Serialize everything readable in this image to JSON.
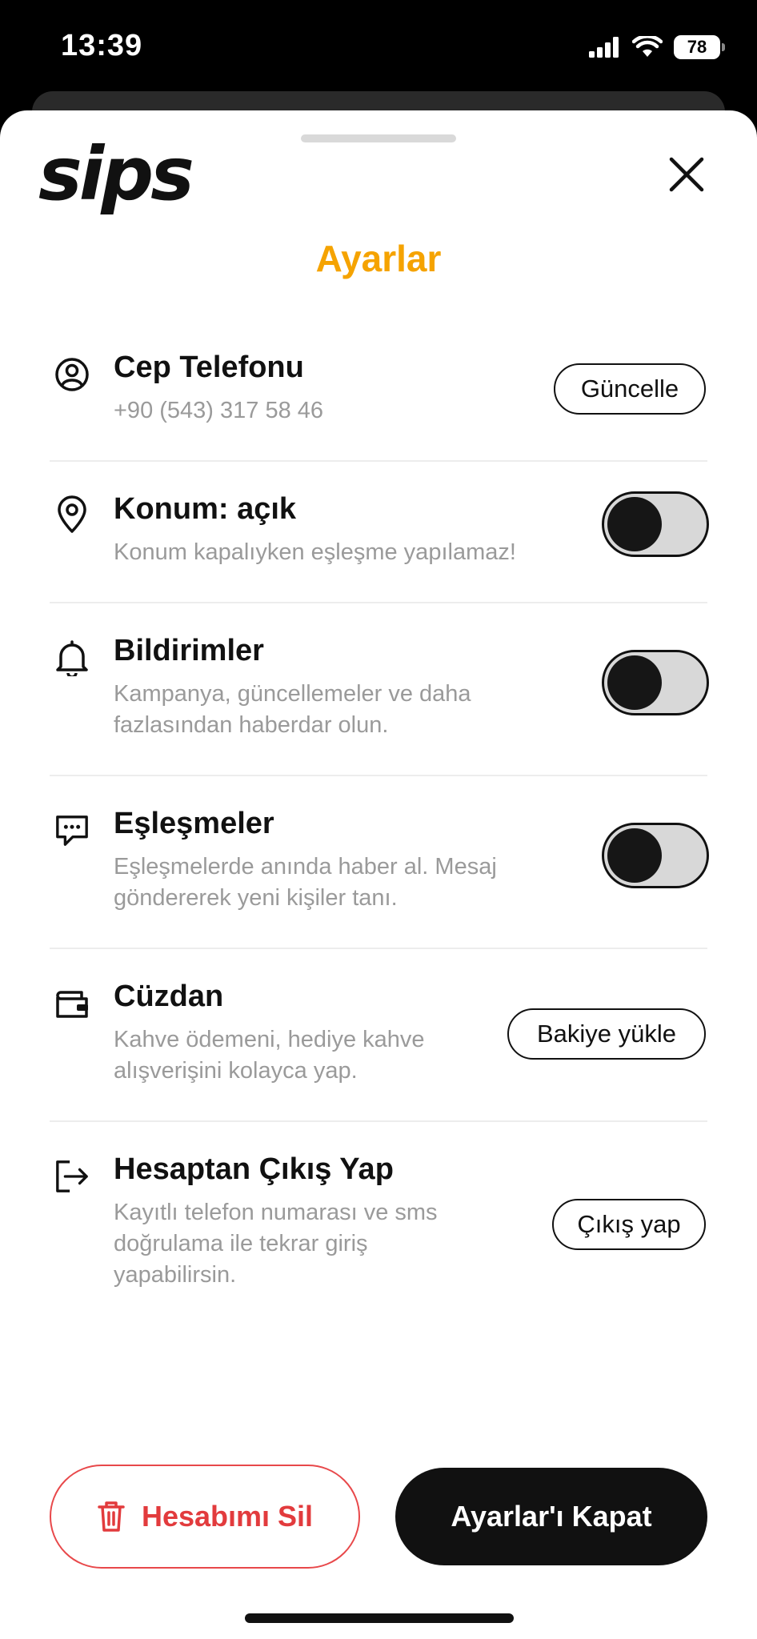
{
  "status_bar": {
    "time": "13:39",
    "battery": "78"
  },
  "sheet": {
    "logo": "sips",
    "title": "Ayarlar",
    "close_icon": "close-icon"
  },
  "settings": [
    {
      "icon": "user-circle-icon",
      "title": "Cep Telefonu",
      "subtitle": "+90 (543) 317 58 46",
      "control": "button",
      "button_label": "Güncelle"
    },
    {
      "icon": "location-pin-icon",
      "title": "Konum: açık",
      "subtitle": "Konum kapalıyken eşleşme yapılamaz!",
      "control": "toggle"
    },
    {
      "icon": "bell-icon",
      "title": "Bildirimler",
      "subtitle": "Kampanya, güncellemeler ve daha\nfazlasından haberdar olun.",
      "control": "toggle"
    },
    {
      "icon": "chat-bubble-icon",
      "title": "Eşleşmeler",
      "subtitle": "Eşleşmelerde anında haber al. Mesaj\ngöndererek yeni kişiler tanı.",
      "control": "toggle"
    },
    {
      "icon": "wallet-icon",
      "title": "Cüzdan",
      "subtitle": "Kahve ödemeni, hediye kahve\nalışverişini kolayca yap.",
      "control": "button",
      "button_label": "Bakiye yükle"
    },
    {
      "icon": "logout-icon",
      "title": "Hesaptan Çıkış Yap",
      "subtitle": "Kayıtlı telefon numarası ve sms\ndoğrulama ile tekrar giriş\nyapabilirsin.",
      "control": "button",
      "button_label": "Çıkış yap"
    }
  ],
  "footer": {
    "delete_label": "Hesabımı Sil",
    "close_label": "Ayarlar'ı Kapat"
  },
  "colors": {
    "accent": "#F5A300",
    "danger": "#E23B3D",
    "dark": "#111111"
  }
}
